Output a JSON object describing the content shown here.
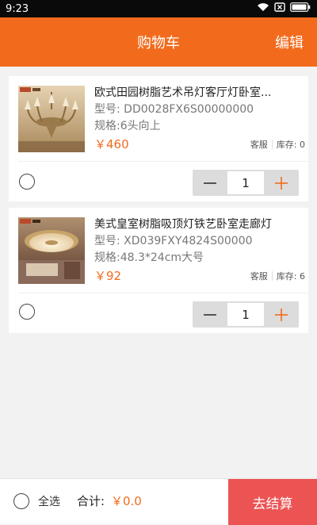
{
  "status_bar": {
    "time": "9:23",
    "icons": [
      "wifi-icon",
      "sim-blocked-icon",
      "battery-icon"
    ]
  },
  "header": {
    "title": "购物车",
    "edit_label": "编辑"
  },
  "cart_items": [
    {
      "name": "欧式田园树脂艺术吊灯客厅灯卧室...",
      "model": "型号: DD0028FX6S00000000",
      "spec": "规格:6头向上",
      "price": "￥460",
      "service_label": "客服",
      "stock": "库存: 0",
      "quantity": "1",
      "checked": false
    },
    {
      "name": "美式皇室树脂吸顶灯铁艺卧室走廊灯",
      "model": "型号: XD039FXY4824S00000",
      "spec": "规格:48.3*24cm大号",
      "price": "￥92",
      "service_label": "客服",
      "stock": "库存: 6",
      "quantity": "1",
      "checked": false
    }
  ],
  "footer": {
    "select_all_label": "全选",
    "total_label": "合计:",
    "total_value": "￥0.0",
    "checkout_label": "去结算"
  },
  "colors": {
    "brand_orange": "#f26b1d",
    "checkout_red": "#ec5353",
    "background": "#f2f2f2"
  }
}
